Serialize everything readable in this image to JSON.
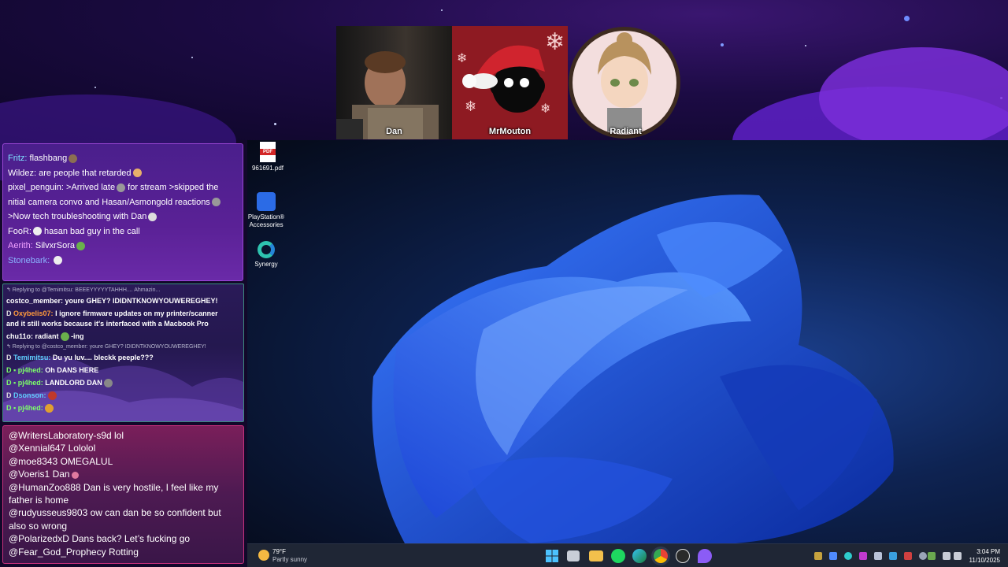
{
  "cameras": [
    {
      "name": "Dan"
    },
    {
      "name": "MrMouton"
    },
    {
      "name": "Radiant"
    }
  ],
  "chat_top": [
    {
      "user": "Fritz:",
      "user_color": "#7ee0ff",
      "text": "flashbang"
    },
    {
      "user": "Wildez:",
      "user_color": "#ffffff",
      "text": "are people that retarded"
    },
    {
      "user": "pixel_penguin:",
      "user_color": "#ffffff",
      "text": ">Arrived late",
      "text2": "for stream >skipped the"
    },
    {
      "user": "",
      "user_color": "#ffffff",
      "text": "nitial camera convo and Hasan/Asmongold reactions"
    },
    {
      "user": "",
      "user_color": "#ffffff",
      "text": ">Now tech troubleshooting with Dan"
    },
    {
      "user": "FooR:",
      "user_color": "#ffffff",
      "text": "hasan bad guy in the call"
    },
    {
      "user": "Aerith:",
      "user_color": "#f0a0ff",
      "text": "SilvxrSora"
    },
    {
      "user": "Stonebark:",
      "user_color": "#8ab4ff",
      "text": ""
    }
  ],
  "chat_middle": [
    {
      "type": "reply",
      "text": "↰ Replying to @Temimitsu: BEEEYYYYYTAHHH.... Ahmazin..."
    },
    {
      "type": "msg",
      "badge": "",
      "user": "costco_member:",
      "user_color": "#ffffff",
      "text": "youre GHEY? IDIDNTKNOWYOUWEREGHEY!"
    },
    {
      "type": "msg",
      "badge": "D",
      "user": "Oxybelis07:",
      "user_color": "#ff9a3c",
      "text": "I ignore firmware updates on my printer/scanner"
    },
    {
      "type": "msg",
      "badge": "",
      "user": "",
      "user_color": "#ffffff",
      "text": "and it still works because it's interfaced with a Macbook Pro"
    },
    {
      "type": "msg",
      "badge": "",
      "user": "chu11o:",
      "user_color": "#ffffff",
      "text": "radiant",
      "text2": "-ing"
    },
    {
      "type": "reply",
      "text": "↰ Replying to @costco_member: youre GHEY? IDIDNTKNOWYOUWEREGHEY!"
    },
    {
      "type": "msg",
      "badge": "D",
      "user": "Temimitsu:",
      "user_color": "#5fd0ff",
      "text": "Du yu luv.... bleckk peeple???"
    },
    {
      "type": "msg",
      "badge": "D ▪",
      "user": "pj4hed:",
      "user_color": "#7dff6a",
      "text": "Oh DANS HERE"
    },
    {
      "type": "msg",
      "badge": "D ▪",
      "user": "pj4hed:",
      "user_color": "#7dff6a",
      "text": "LANDLORD DAN"
    },
    {
      "type": "msg",
      "badge": "D",
      "user": "Dsonson:",
      "user_color": "#5fd0ff",
      "text": ""
    },
    {
      "type": "msg",
      "badge": "D ▪",
      "user": "pj4hed:",
      "user_color": "#7dff6a",
      "text": ""
    }
  ],
  "chat_bottom": [
    {
      "user": "@WritersLaboratory-s9d",
      "text": "lol"
    },
    {
      "user": "@Xennial647",
      "text": "Lololol"
    },
    {
      "user": "@moe8343",
      "text": "OMEGALUL"
    },
    {
      "user": "@Voeris1",
      "text": "Dan"
    },
    {
      "user": "@HumanZoo888",
      "text": "Dan is very hostile, I feel like my father is home"
    },
    {
      "user": "@rudyusseus9803",
      "text": "ow can dan be so confident but also so wrong"
    },
    {
      "user": "@PolarizedxD",
      "text": "Dans back? Let’s fucking go"
    },
    {
      "user": "@Fear_God_Prophecy",
      "text": "Rotting"
    }
  ],
  "desktop_icons": [
    {
      "label": "961691.pdf",
      "icon": "pdf-file-icon"
    },
    {
      "label": "PlayStation® Accessories",
      "icon": "playstation-accessories-icon"
    },
    {
      "label": "Synergy",
      "icon": "synergy-icon"
    }
  ],
  "taskbar": {
    "weather_temp": "79°F",
    "weather_desc": "Partly sunny",
    "time": "3:04 PM",
    "date": "11/10/2025",
    "apps": [
      "start-icon",
      "task-view-icon",
      "file-explorer-icon",
      "spotify-icon",
      "edge-icon",
      "chrome-icon",
      "obs-icon",
      "app-icon"
    ]
  },
  "colors": {
    "accent_purple": "#9b46d6",
    "accent_green": "#3c8c7e",
    "accent_pink": "#c7307c",
    "taskbar": "#1f2635"
  }
}
